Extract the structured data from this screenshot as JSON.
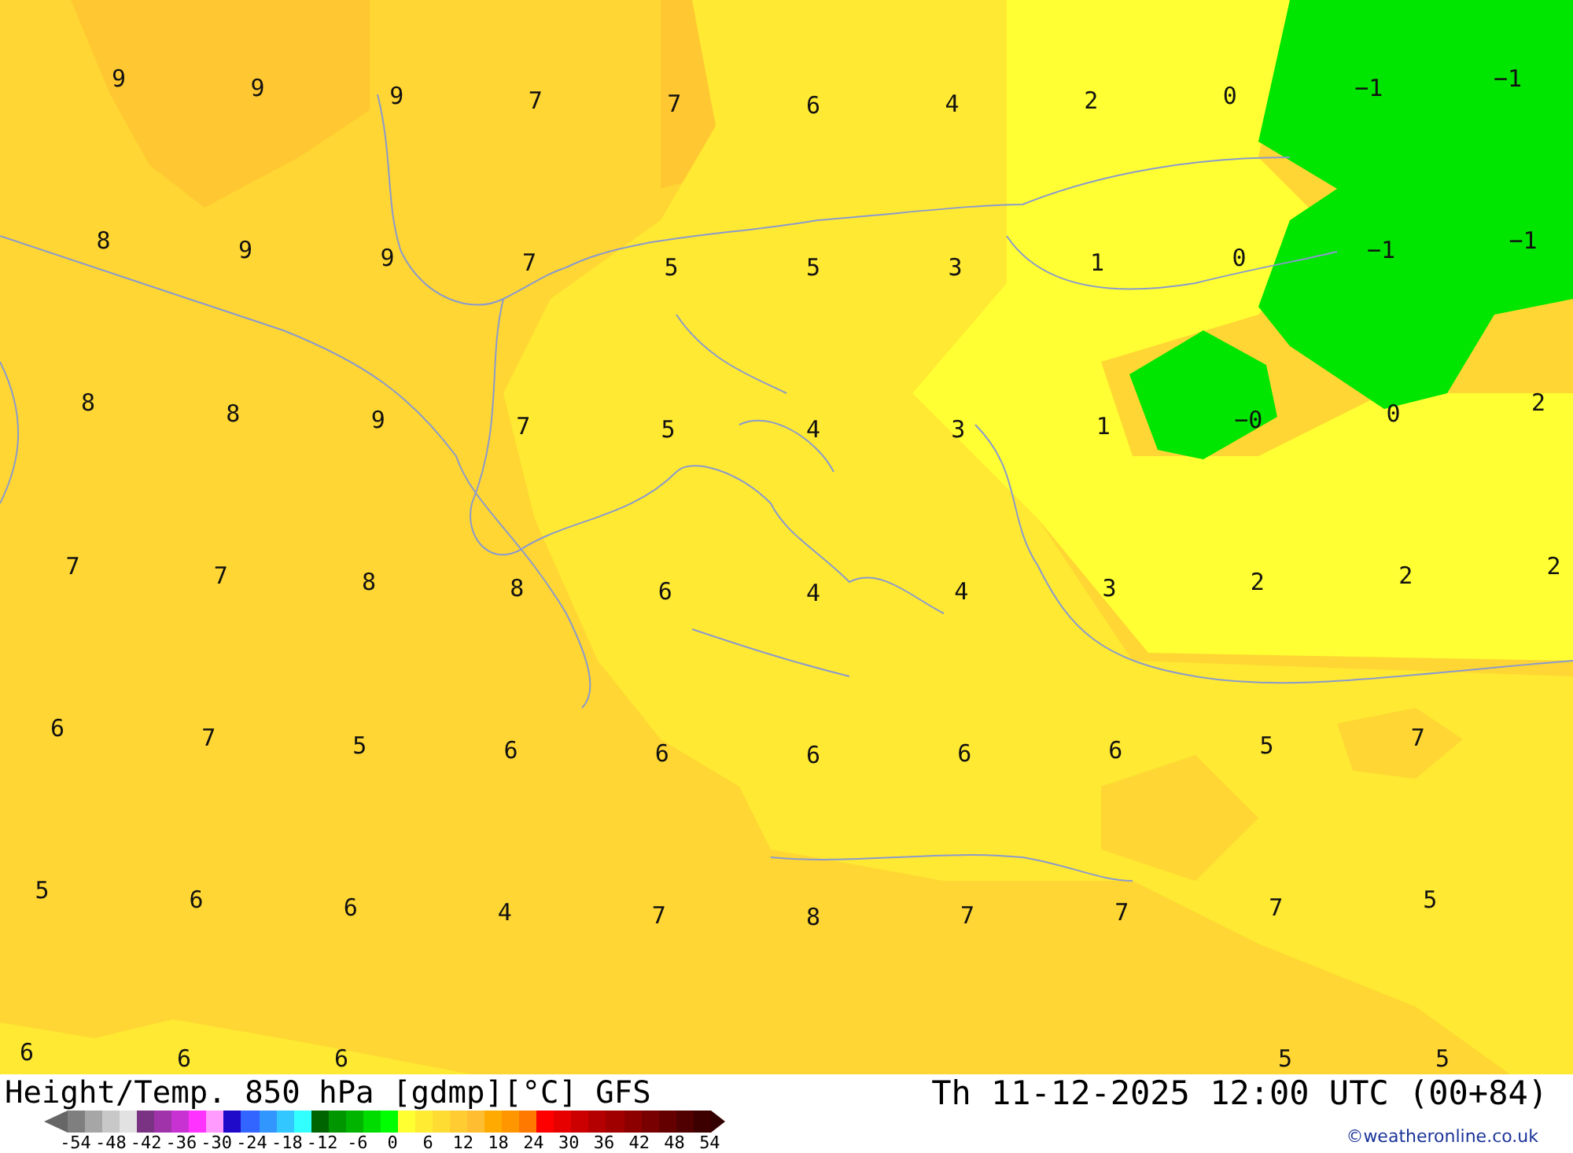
{
  "map": {
    "label_rows": [
      [
        "9",
        "9",
        "9",
        "7",
        "7",
        "6",
        "4",
        "2",
        "0",
        "−1",
        "−1"
      ],
      [
        "8",
        "9",
        "9",
        "7",
        "5",
        "5",
        "3",
        "1",
        "0",
        "−1",
        "−1"
      ],
      [
        "8",
        "8",
        "9",
        "7",
        "5",
        "4",
        "3",
        "1",
        "−0",
        "0",
        "2"
      ],
      [
        "7",
        "7",
        "8",
        "8",
        "6",
        "4",
        "4",
        "3",
        "2",
        "2",
        "2"
      ],
      [
        "6",
        "7",
        "5",
        "6",
        "6",
        "6",
        "6",
        "6",
        "5",
        "7",
        null
      ],
      [
        "5",
        "6",
        "6",
        "4",
        "7",
        "8",
        "7",
        "7",
        "7",
        "5",
        null
      ],
      [
        "6",
        "6",
        "6",
        null,
        null,
        null,
        null,
        null,
        "5",
        "5",
        null
      ]
    ]
  },
  "footer": {
    "title": "Height/Temp. 850 hPa [gdmp][°C] GFS",
    "valid_time": "Th 11-12-2025 12:00 UTC (00+84)",
    "credit": "©weatheronline.co.uk"
  },
  "legend": {
    "swatches": [
      {
        "color": "#7f7f7f"
      },
      {
        "color": "#a6a6a6"
      },
      {
        "color": "#c8c8c8"
      },
      {
        "color": "#e2e2e2"
      },
      {
        "color": "#7a3282"
      },
      {
        "color": "#a032aa"
      },
      {
        "color": "#c832d2"
      },
      {
        "color": "#ff32ff"
      },
      {
        "color": "#ff9aff"
      },
      {
        "color": "#1e0ac8"
      },
      {
        "color": "#3264ff"
      },
      {
        "color": "#3296ff"
      },
      {
        "color": "#32c8ff"
      },
      {
        "color": "#32ffff"
      },
      {
        "color": "#006400"
      },
      {
        "color": "#009600"
      },
      {
        "color": "#00b400"
      },
      {
        "color": "#00dc00"
      },
      {
        "color": "#00ff00"
      },
      {
        "color": "#ffff32"
      },
      {
        "color": "#ffeb32"
      },
      {
        "color": "#ffdc32"
      },
      {
        "color": "#ffcd32"
      },
      {
        "color": "#ffbe32"
      },
      {
        "color": "#ffaa00"
      },
      {
        "color": "#ff9600"
      },
      {
        "color": "#ff7800"
      },
      {
        "color": "#ff0000"
      },
      {
        "color": "#e60000"
      },
      {
        "color": "#cc0000"
      },
      {
        "color": "#b40000"
      },
      {
        "color": "#a00000"
      },
      {
        "color": "#8c0000"
      },
      {
        "color": "#780000"
      },
      {
        "color": "#640000"
      },
      {
        "color": "#500000"
      },
      {
        "color": "#3c0000"
      }
    ],
    "ticks": [
      "-54",
      "-48",
      "-42",
      "-36",
      "-30",
      "-24",
      "-18",
      "-12",
      "-6",
      "0",
      "6",
      "12",
      "18",
      "24",
      "30",
      "36",
      "42",
      "48",
      "54"
    ]
  }
}
